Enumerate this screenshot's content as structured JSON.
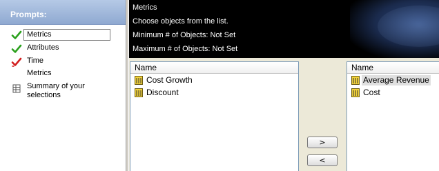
{
  "prompts": {
    "title": "Prompts:",
    "items": [
      {
        "label": "Metrics",
        "icon": "green-check-icon",
        "selected": true
      },
      {
        "label": "Attributes",
        "icon": "green-check-icon",
        "selected": false
      },
      {
        "label": "Time",
        "icon": "red-check-icon",
        "selected": false
      },
      {
        "label": "Metrics",
        "icon": "none",
        "selected": false
      },
      {
        "label": "Summary of your selections",
        "icon": "summary-grid-icon",
        "selected": false
      }
    ]
  },
  "banner": {
    "title": "Metrics",
    "instruction": "Choose objects from the list.",
    "min_objects": "Minimum # of Objects: Not Set",
    "max_objects": "Maximum # of Objects: Not Set"
  },
  "available_list": {
    "header": "Name",
    "items": [
      {
        "label": "Cost Growth",
        "icon": "metric-icon"
      },
      {
        "label": "Discount",
        "icon": "metric-icon"
      }
    ]
  },
  "selected_list": {
    "header": "Name",
    "items": [
      {
        "label": "Average Revenue",
        "icon": "metric-icon",
        "highlighted": true
      },
      {
        "label": "Cost",
        "icon": "metric-icon",
        "highlighted": false
      }
    ]
  },
  "buttons": {
    "add": ">",
    "remove": "<"
  },
  "colors": {
    "header_gradient_top": "#b5c9e6",
    "header_gradient_bottom": "#8fa9d1",
    "check_green": "#2aa01c",
    "check_red": "#d21e1e",
    "banner_bg": "#000000"
  }
}
